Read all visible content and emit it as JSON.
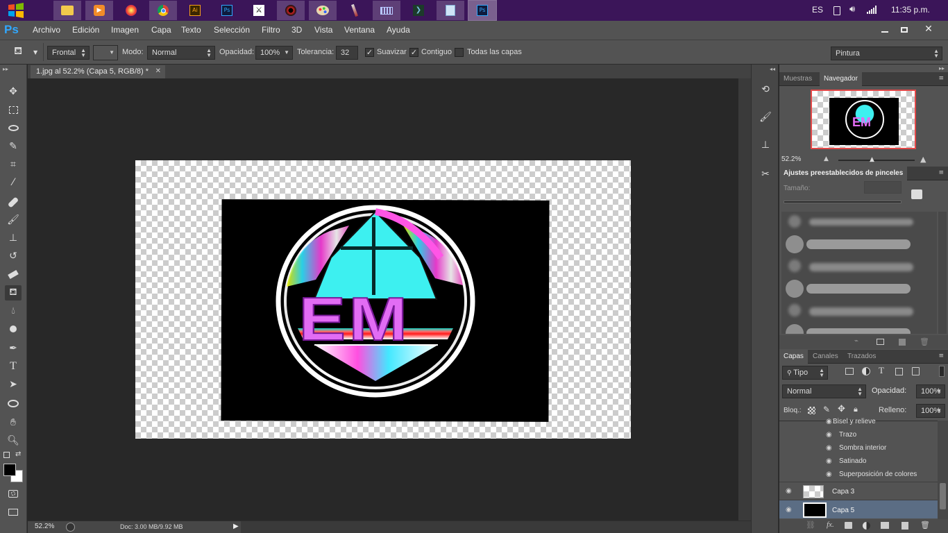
{
  "taskbar": {
    "language": "ES",
    "clock": "11:35 p.m.",
    "apps": [
      "file-explorer",
      "media-player",
      "paint-app",
      "chrome",
      "illustrator",
      "photoshop-old",
      "counter-strike",
      "music-app",
      "paint-palette",
      "pen-tool-app",
      "keyboard-app",
      "arrow-app",
      "notepad",
      "photoshop"
    ]
  },
  "app": {
    "logo": "Ps"
  },
  "menu": [
    "Archivo",
    "Edición",
    "Imagen",
    "Capa",
    "Texto",
    "Selección",
    "Filtro",
    "3D",
    "Vista",
    "Ventana",
    "Ayuda"
  ],
  "options": {
    "fill_source": "Frontal",
    "mode_label": "Modo:",
    "mode_value": "Normal",
    "opacity_label": "Opacidad:",
    "opacity_value": "100%",
    "tolerance_label": "Tolerancia:",
    "tolerance_value": "32",
    "smooth_label": "Suavizar",
    "contiguous_label": "Contiguo",
    "all_layers_label": "Todas las capas",
    "workspace": "Pintura"
  },
  "document": {
    "tab_title": "1.jpg al 52.2% (Capa 5, RGB/8) *",
    "logo_text": "EM",
    "zoom": "52.2%",
    "doc_size": "Doc: 3.00 MB/9.92 MB"
  },
  "navigator": {
    "tabs": [
      "Muestras",
      "Navegador"
    ],
    "active_tab": "Navegador",
    "zoom": "52.2%",
    "thumb_text": "EM"
  },
  "brush_presets": {
    "title": "Ajustes preestablecidos de pinceles",
    "size_label": "Tamaño:"
  },
  "layers": {
    "tabs": [
      "Capas",
      "Canales",
      "Trazados"
    ],
    "active_tab": "Capas",
    "filter_kind": "Tipo",
    "blend_mode": "Normal",
    "opacity_label": "Opacidad:",
    "opacity_value": "100%",
    "lock_label": "Bloq.:",
    "fill_label": "Relleno:",
    "fill_value": "100%",
    "effects": [
      "Bisel y relieve",
      "Trazo",
      "Sombra interior",
      "Satinado",
      "Superposición de colores"
    ],
    "items": [
      {
        "name": "Capa 3",
        "selected": false
      },
      {
        "name": "Capa 5",
        "selected": true
      }
    ]
  },
  "colors": {
    "accent_nav_frame": "#e34848",
    "taskbar": "#3b1559",
    "selected_layer": "#5b6d84"
  }
}
